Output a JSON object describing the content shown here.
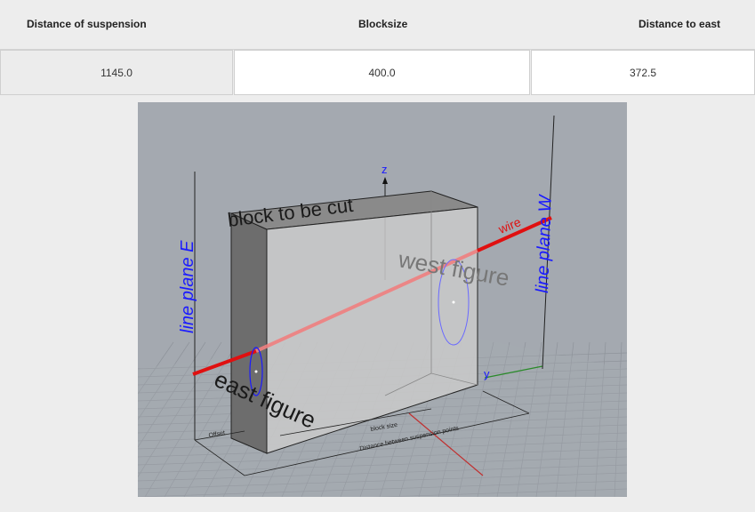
{
  "table": {
    "headers": [
      "Distance of suspension",
      "Blocksize",
      "Distance to east"
    ],
    "values": [
      "1145.0",
      "400.0",
      "372.5"
    ]
  },
  "viewport": {
    "labels": {
      "block": "block to be cut",
      "west_figure": "west figure",
      "east_figure": "east figure",
      "line_plane_e": "line plane E",
      "line_plane_w": "line plane W",
      "wire": "wire",
      "axis_z": "z",
      "axis_y": "y",
      "dim_offset": "Offset",
      "dim_block": "block size",
      "dim_distance": "Distance between suspension points"
    },
    "colors": {
      "background": "#a4a9b0",
      "wire": "#e01010",
      "plane_label": "#1a1aff",
      "axis_x": "#c03030",
      "axis_y": "#2a8a2a",
      "axis_z": "#1a1aff"
    }
  }
}
